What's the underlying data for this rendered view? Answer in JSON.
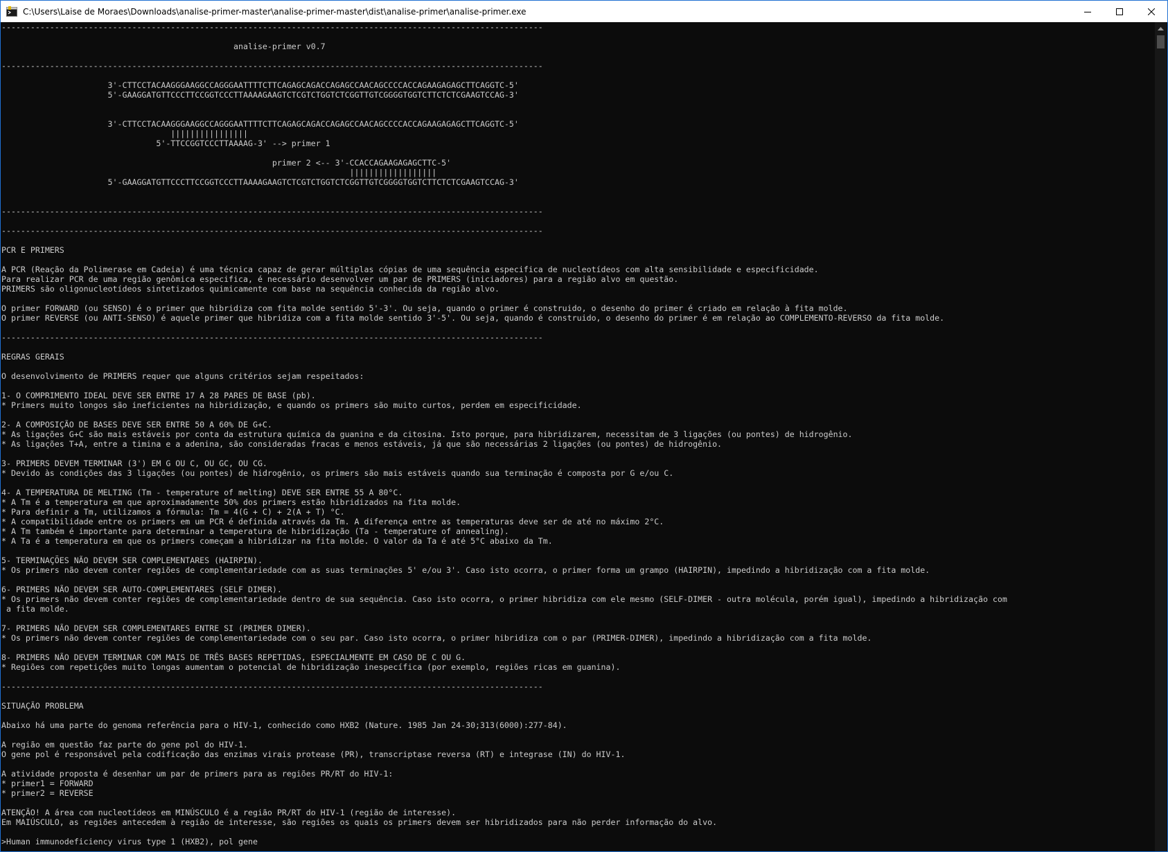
{
  "window": {
    "title": "C:\\Users\\Laise de Moraes\\Downloads\\analise-primer-master\\analise-primer-master\\dist\\analise-primer\\analise-primer.exe"
  },
  "console": {
    "lines": [
      "----------------------------------------------------------------------------------------------------------------",
      "",
      "                                                analise-primer v0.7",
      "",
      "----------------------------------------------------------------------------------------------------------------",
      "",
      "                      3'-CTTCCTACAAGGGAAGGCCAGGGAATTTTCTTCAGAGCAGACCAGAGCCAACAGCCCCACCAGAAGAGAGCTTCAGGTC-5'",
      "                      5'-GAAGGATGTTCCCTTCCGGTCCCTTAAAAGAAGTCTCGTCTGGTCTCGGTTGTCGGGGTGGTCTTCTCTCGAAGTCCAG-3'",
      "",
      "",
      "                      3'-CTTCCTACAAGGGAAGGCCAGGGAATTTTCTTCAGAGCAGACCAGAGCCAACAGCCCCACCAGAAGAGAGCTTCAGGTC-5'",
      "                                   ||||||||||||||||",
      "                                5'-TTCCGGTCCCTTAAAAG-3' --> primer 1",
      "",
      "                                                        primer 2 <-- 3'-CCACCAGAAGAGAGCTTC-5'",
      "                                                                        ||||||||||||||||||",
      "                      5'-GAAGGATGTTCCCTTCCGGTCCCTTAAAAGAAGTCTCGTCTGGTCTCGGTTGTCGGGGTGGTCTTCTCTCGAAGTCCAG-3'",
      "",
      "",
      "----------------------------------------------------------------------------------------------------------------",
      "",
      "----------------------------------------------------------------------------------------------------------------",
      "",
      "PCR E PRIMERS",
      "",
      "A PCR (Reação da Polimerase em Cadeia) é uma técnica capaz de gerar múltiplas cópias de uma sequência especifica de nucleotídeos com alta sensibilidade e especificidade.",
      "Para realizar PCR de uma região genômica especifica, é necessário desenvolver um par de PRIMERS (iniciadores) para a região alvo em questão.",
      "PRIMERS são oligonucleotídeos sintetizados quimicamente com base na sequência conhecida da região alvo.",
      "",
      "O primer FORWARD (ou SENSO) é o primer que hibridiza com fita molde sentido 5'-3'. Ou seja, quando o primer é construido, o desenho do primer é criado em relação à fita molde.",
      "O primer REVERSE (ou ANTI-SENSO) é aquele primer que hibridiza com a fita molde sentido 3'-5'. Ou seja, quando é construido, o desenho do primer é em relação ao COMPLEMENTO-REVERSO da fita molde.",
      "",
      "----------------------------------------------------------------------------------------------------------------",
      "",
      "REGRAS GERAIS",
      "",
      "O desenvolvimento de PRIMERS requer que alguns critérios sejam respeitados:",
      "",
      "1- O COMPRIMENTO IDEAL DEVE SER ENTRE 17 A 28 PARES DE BASE (pb).",
      "* Primers muito longos são ineficientes na hibridização, e quando os primers são muito curtos, perdem em especificidade.",
      "",
      "2- A COMPOSIÇÃO DE BASES DEVE SER ENTRE 50 A 60% DE G+C.",
      "* As ligações G+C são mais estáveis por conta da estrutura química da guanina e da citosina. Isto porque, para hibridizarem, necessitam de 3 ligações (ou pontes) de hidrogênio.",
      "* As ligações T+A, entre a timina e a adenina, são consideradas fracas e menos estáveis, já que são necessárias 2 ligações (ou pontes) de hidrogênio.",
      "",
      "3- PRIMERS DEVEM TERMINAR (3') EM G OU C, OU GC, OU CG.",
      "* Devido às condições das 3 ligações (ou pontes) de hidrogênio, os primers são mais estáveis quando sua terminação é composta por G e/ou C.",
      "",
      "4- A TEMPERATURA DE MELTING (Tm - temperature of melting) DEVE SER ENTRE 55 A 80°C.",
      "* A Tm é a temperatura em que aproximadamente 50% dos primers estão hibridizados na fita molde.",
      "* Para definir a Tm, utilizamos a fórmula: Tm = 4(G + C) + 2(A + T) °C.",
      "* A compatibilidade entre os primers em um PCR é definida através da Tm. A diferença entre as temperaturas deve ser de até no máximo 2°C.",
      "* A Tm também é importante para determinar a temperatura de hibridização (Ta - temperature of annealing).",
      "* A Ta é a temperatura em que os primers começam a hibridizar na fita molde. O valor da Ta é até 5°C abaixo da Tm.",
      "",
      "5- TERMINAÇÕES NÃO DEVEM SER COMPLEMENTARES (HAIRPIN).",
      "* Os primers não devem conter regiões de complementariedade com as suas terminações 5' e/ou 3'. Caso isto ocorra, o primer forma um grampo (HAIRPIN), impedindo a hibridização com a fita molde.",
      "",
      "6- PRIMERS NÃO DEVEM SER AUTO-COMPLEMENTARES (SELF DIMER).",
      "* Os primers não devem conter regiões de complementariedade dentro de sua sequência. Caso isto ocorra, o primer hibridiza com ele mesmo (SELF-DIMER - outra molécula, porém igual), impedindo a hibridização com",
      " a fita molde.",
      "",
      "7- PRIMERS NÃO DEVEM SER COMPLEMENTARES ENTRE SI (PRIMER DIMER).",
      "* Os primers não devem conter regiões de complementariedade com o seu par. Caso isto ocorra, o primer hibridiza com o par (PRIMER-DIMER), impedindo a hibridização com a fita molde.",
      "",
      "8- PRIMERS NÃO DEVEM TERMINAR COM MAIS DE TRÊS BASES REPETIDAS, ESPECIALMENTE EM CASO DE C OU G.",
      "* Regiões com repetições muito longas aumentam o potencial de hibridização inespecífica (por exemplo, regiões ricas em guanina).",
      "",
      "----------------------------------------------------------------------------------------------------------------",
      "",
      "SITUAÇÃO PROBLEMA",
      "",
      "Abaixo há uma parte do genoma referência para o HIV-1, conhecido como HXB2 (Nature. 1985 Jan 24-30;313(6000):277-84).",
      "",
      "A região em questão faz parte do gene pol do HIV-1.",
      "O gene pol é responsável pela codificação das enzimas virais protease (PR), transcriptase reversa (RT) e integrase (IN) do HIV-1.",
      "",
      "A atividade proposta é desenhar um par de primers para as regiões PR/RT do HIV-1:",
      "* primer1 = FORWARD",
      "* primer2 = REVERSE",
      "",
      "ATENÇÃO! A área com nucleotídeos em MINÚSCULO é a região PR/RT do HIV-1 (região de interesse).",
      "Em MAIÚSCULO, as regiões antecedem à região de interesse, são regiões os quais os primers devem ser hibridizados para não perder informação do alvo.",
      "",
      ">Human immunodeficiency virus type 1 (HXB2), pol gene"
    ]
  }
}
